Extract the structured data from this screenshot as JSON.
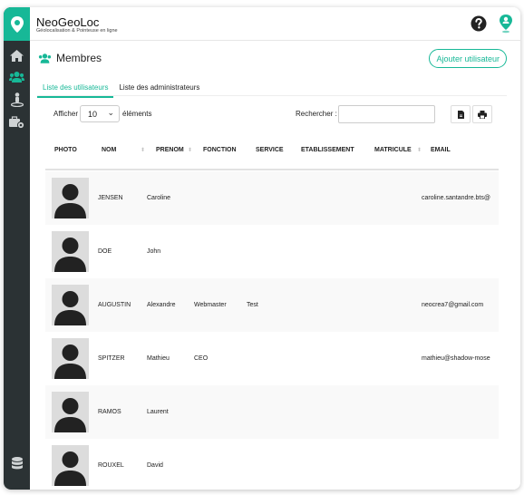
{
  "header": {
    "app_title": "NeoGeoLoc",
    "app_subtitle": "Géolocalisation & Pointeuse en ligne"
  },
  "sidebar": {
    "items": [
      {
        "icon": "home-icon"
      },
      {
        "icon": "users-icon"
      },
      {
        "icon": "location-person-icon"
      },
      {
        "icon": "briefcase-settings-icon"
      }
    ],
    "bottom_icon": "database-icon"
  },
  "page": {
    "title": "Membres",
    "add_button": "Ajouter utilisateur",
    "tabs": [
      "Liste des utilisateurs",
      "Liste des administrateurs"
    ],
    "active_tab": 0,
    "show_label": "Afficher",
    "show_value": "10",
    "elements_label": "éléments",
    "search_label": "Rechercher :",
    "search_value": ""
  },
  "table": {
    "columns": [
      "PHOTO",
      "NOM",
      "PRENOM",
      "FONCTION",
      "SERVICE",
      "ETABLISSEMENT",
      "MATRICULE",
      "EMAIL"
    ],
    "rows": [
      {
        "nom": "JENSEN",
        "prenom": "Caroline",
        "fonction": "",
        "service": "",
        "email": "caroline.santandre.bts@"
      },
      {
        "nom": "DOE",
        "prenom": "John",
        "fonction": "",
        "service": "",
        "email": ""
      },
      {
        "nom": "AUGUSTIN",
        "prenom": "Alexandre",
        "fonction": "Webmaster",
        "service": "Test",
        "email": "neocrea7@gmail.com"
      },
      {
        "nom": "SPITZER",
        "prenom": "Mathieu",
        "fonction": "CEO",
        "service": "",
        "email": "mathieu@shadow-mose"
      },
      {
        "nom": "RAMOS",
        "prenom": "Laurent",
        "fonction": "",
        "service": "",
        "email": ""
      },
      {
        "nom": "ROUXEL",
        "prenom": "David",
        "fonction": "",
        "service": "",
        "email": ""
      }
    ]
  },
  "colors": {
    "accent": "#17b897",
    "sidebar_bg": "#2b3234"
  }
}
